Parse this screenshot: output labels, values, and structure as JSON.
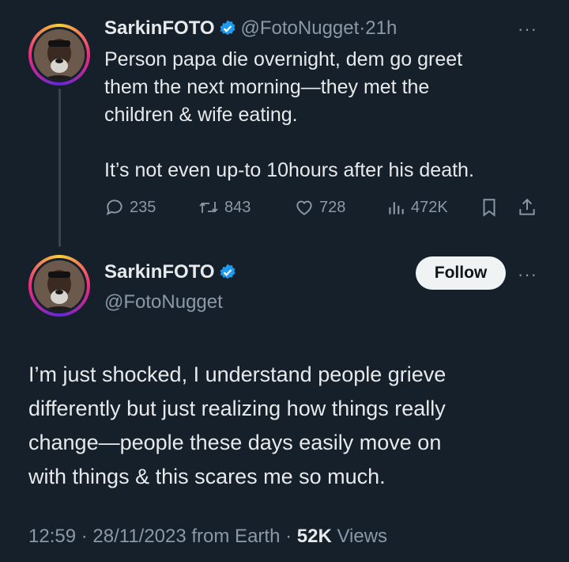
{
  "tweet1": {
    "name": "SarkinFOTO",
    "handle": "@FotoNugget",
    "separator": "·",
    "time": "21h",
    "more_label": "···",
    "text": "Person papa die overnight, dem go greet\nthem the next morning—they met the\nchildren & wife eating.\n\nIt’s not even up-to 10hours after his death.",
    "actions": {
      "replies": "235",
      "retweets": "843",
      "likes": "728",
      "views": "472K"
    },
    "icons": [
      "reply-icon",
      "retweet-icon",
      "like-icon",
      "views-icon",
      "bookmark-icon",
      "share-icon"
    ]
  },
  "tweet2": {
    "name": "SarkinFOTO",
    "handle": "@FotoNugget",
    "follow_label": "Follow",
    "more_label": "···",
    "text": "I’m just shocked, I understand people grieve\ndifferently but just realizing how things really\nchange—people these days easily move on\nwith things & this scares me so much.",
    "timestamp": "12:59 · 28/11/2023 from Earth · ",
    "views_count": "52K",
    "views_label": " Views"
  },
  "colors": {
    "background": "#15202b",
    "text": "#e7e9ea",
    "muted": "#8b98a5",
    "verified": "#1d9bf0"
  }
}
